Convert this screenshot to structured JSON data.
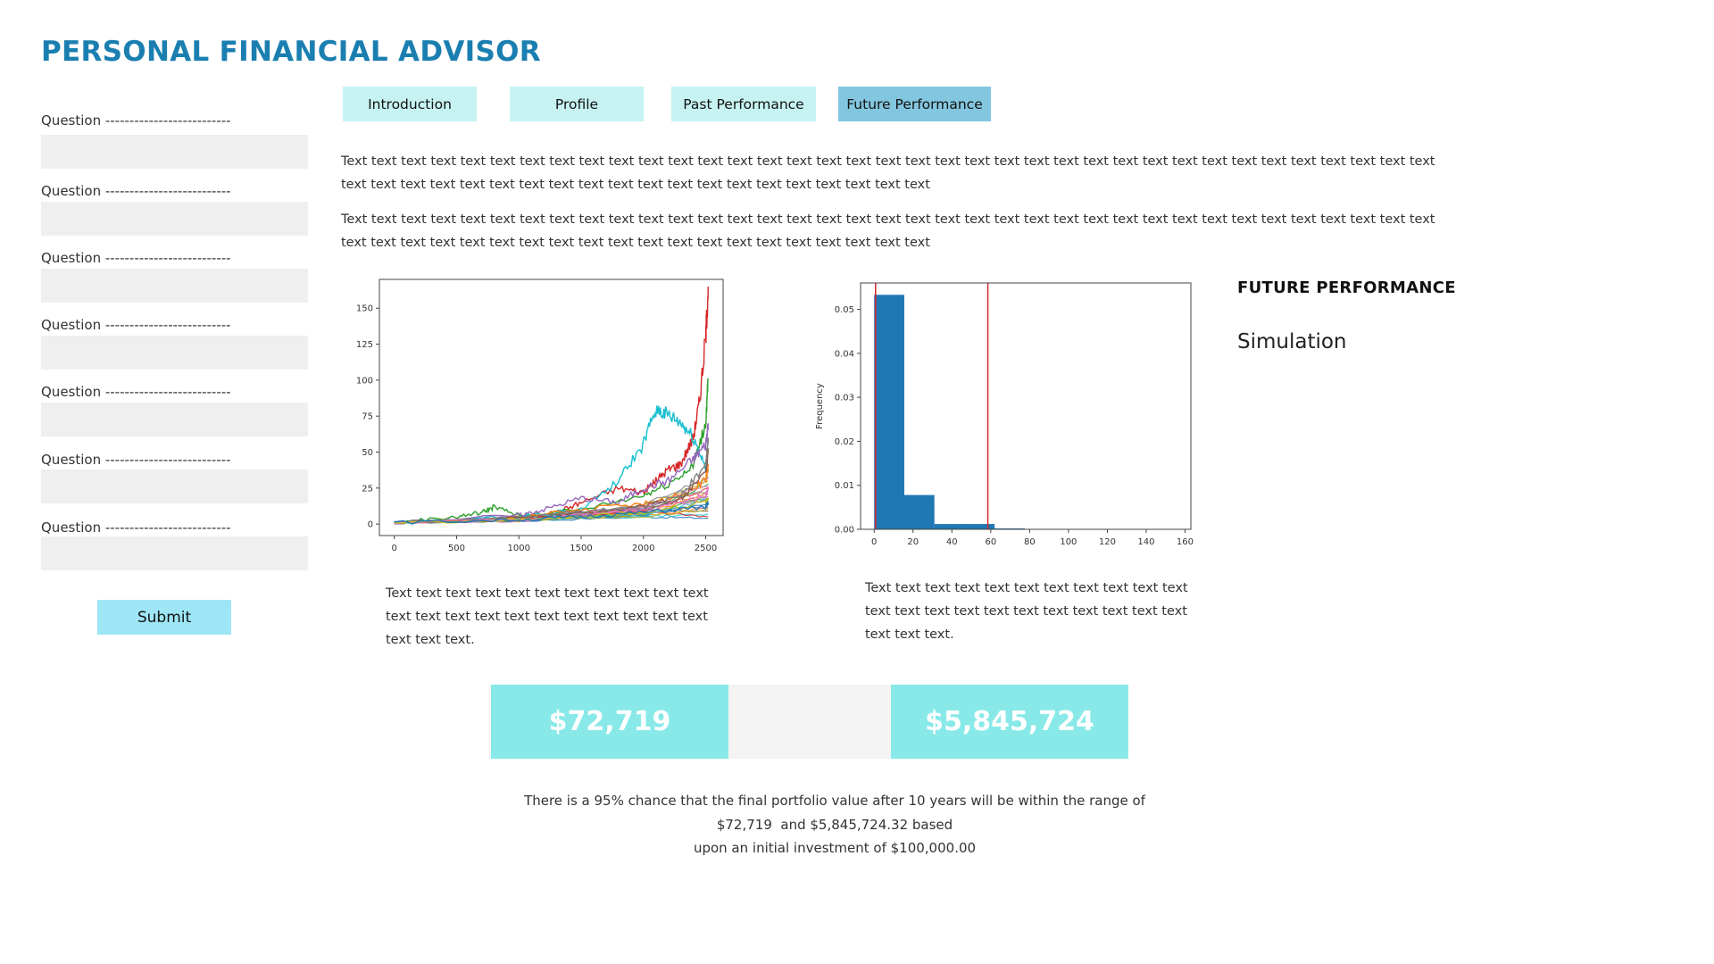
{
  "app": {
    "title": "PERSONAL FINANCIAL ADVISOR"
  },
  "sidebar": {
    "questions": [
      {
        "label": "Question --------------------------",
        "value": ""
      },
      {
        "label": "Question --------------------------",
        "value": ""
      },
      {
        "label": "Question --------------------------",
        "value": ""
      },
      {
        "label": "Question --------------------------",
        "value": ""
      },
      {
        "label": "Question --------------------------",
        "value": ""
      },
      {
        "label": "Question --------------------------",
        "value": ""
      },
      {
        "label": "Question --------------------------",
        "value": ""
      }
    ],
    "submit_label": "Submit"
  },
  "tabs": [
    {
      "label": "Introduction",
      "active": false
    },
    {
      "label": "Profile",
      "active": false
    },
    {
      "label": "Past Performance",
      "active": false
    },
    {
      "label": "Future Performance",
      "active": true
    }
  ],
  "content": {
    "paragraphs": [
      "Text text text text text text text text text text text text text text text text text text text text text text text text text text text text text text text text text text text text text text text text text text text text text text text text text text text text text text text text text",
      "Text text text text text text text text text text text text text text text text text text text text text text text text text text text text text text text text text text text text text text text text text text text text text text text text text text text text text text text text text"
    ],
    "caption_left": "Text text text text text text text text text text text text text text text text text text text text text text text text text.",
    "caption_right": "Text text text text text text text text text text text text text text text text text text text text text text text text text.",
    "section_heading": "FUTURE PERFORMANCE",
    "section_sub": "Simulation"
  },
  "results": {
    "lower_value": "$72,719",
    "upper_value": "$5,845,724",
    "summary_lines": [
      "There is a 95% chance that the final portfolio value after 10 years will be within the range of",
      "$72,719  and $5,845,724.32 based",
      "upon an initial investment of $100,000.00"
    ]
  },
  "colors": {
    "title": "#1a7fb0",
    "tab": "#c6f3f2",
    "tab_active": "#83c6df",
    "submit": "#9ee6f5",
    "result_box": "#88e9e8",
    "hist_bar": "#1f77b4",
    "hist_line": "#d62728"
  },
  "chart_data": [
    {
      "type": "line",
      "title": "",
      "xlabel": "",
      "ylabel": "",
      "xlim": [
        -120,
        2640
      ],
      "ylim": [
        -8,
        170
      ],
      "xticks": [
        0,
        500,
        1000,
        1500,
        2000,
        2500
      ],
      "yticks": [
        0,
        25,
        50,
        75,
        100,
        125,
        150
      ],
      "series": [
        {
          "color": "#d62728",
          "x": [
            0,
            1000,
            1300,
            1500,
            1800,
            2000,
            2100,
            2200,
            2300,
            2400,
            2450,
            2500,
            2520
          ],
          "y": [
            1,
            3,
            8,
            15,
            25,
            22,
            30,
            38,
            42,
            60,
            85,
            130,
            165
          ]
        },
        {
          "color": "#2ca02c",
          "x": [
            0,
            500,
            700,
            800,
            1000,
            1500,
            2000,
            2200,
            2400,
            2500,
            2520
          ],
          "y": [
            1,
            5,
            8,
            12,
            6,
            10,
            20,
            28,
            40,
            70,
            100
          ]
        },
        {
          "color": "#17becf",
          "x": [
            0,
            1000,
            1500,
            1800,
            2000,
            2100,
            2200,
            2300,
            2400,
            2500,
            2520
          ],
          "y": [
            1,
            5,
            10,
            30,
            55,
            80,
            75,
            70,
            60,
            40,
            38
          ]
        },
        {
          "color": "#9467bd",
          "x": [
            0,
            1000,
            1200,
            1500,
            1800,
            2000,
            2200,
            2400,
            2500,
            2520
          ],
          "y": [
            1,
            6,
            10,
            18,
            15,
            25,
            30,
            45,
            55,
            70
          ]
        },
        {
          "color": "#ff7f0e",
          "x": [
            0,
            1000,
            1500,
            2000,
            2300,
            2500,
            2520
          ],
          "y": [
            1,
            4,
            10,
            14,
            20,
            30,
            40
          ]
        },
        {
          "color": "#8c564b",
          "x": [
            0,
            1000,
            1500,
            2000,
            2300,
            2500,
            2520
          ],
          "y": [
            1,
            4,
            8,
            12,
            18,
            35,
            50
          ]
        },
        {
          "color": "#7f7f7f",
          "x": [
            0,
            1000,
            1500,
            2000,
            2300,
            2500,
            2520
          ],
          "y": [
            1,
            4,
            8,
            12,
            20,
            40,
            60
          ]
        },
        {
          "color": "#e377c2",
          "x": [
            0,
            1000,
            1500,
            2000,
            2300,
            2500,
            2520
          ],
          "y": [
            1,
            3,
            6,
            10,
            15,
            20,
            25
          ]
        },
        {
          "color": "#bcbd22",
          "x": [
            0,
            1000,
            1500,
            2000,
            2500,
            2520
          ],
          "y": [
            1,
            3,
            5,
            8,
            15,
            18
          ]
        },
        {
          "color": "#1f77b4",
          "x": [
            0,
            1000,
            1500,
            2000,
            2500,
            2520
          ],
          "y": [
            1,
            3,
            5,
            8,
            12,
            15
          ]
        }
      ]
    },
    {
      "type": "bar",
      "title": "",
      "xlabel": "",
      "ylabel": "Frequency",
      "xlim": [
        -7,
        163
      ],
      "ylim": [
        0,
        0.056
      ],
      "xticks": [
        0,
        20,
        40,
        60,
        80,
        100,
        120,
        140,
        160
      ],
      "yticks": [
        0.0,
        0.01,
        0.02,
        0.03,
        0.04,
        0.05
      ],
      "ytick_labels": [
        "0.00",
        "0.01",
        "0.02",
        "0.03",
        "0.04",
        "0.05"
      ],
      "bins": [
        {
          "x0": 0,
          "x1": 15.5,
          "value": 0.0533
        },
        {
          "x0": 15.5,
          "x1": 31,
          "value": 0.0078
        },
        {
          "x0": 31,
          "x1": 46.5,
          "value": 0.0012
        },
        {
          "x0": 46.5,
          "x1": 62,
          "value": 0.0012
        },
        {
          "x0": 62,
          "x1": 77.5,
          "value": 0.0002
        },
        {
          "x0": 93,
          "x1": 108.5,
          "value": 0.0001
        },
        {
          "x0": 139.5,
          "x1": 155,
          "value": 0.0001
        }
      ],
      "vlines": [
        0.7,
        58.5
      ]
    }
  ]
}
